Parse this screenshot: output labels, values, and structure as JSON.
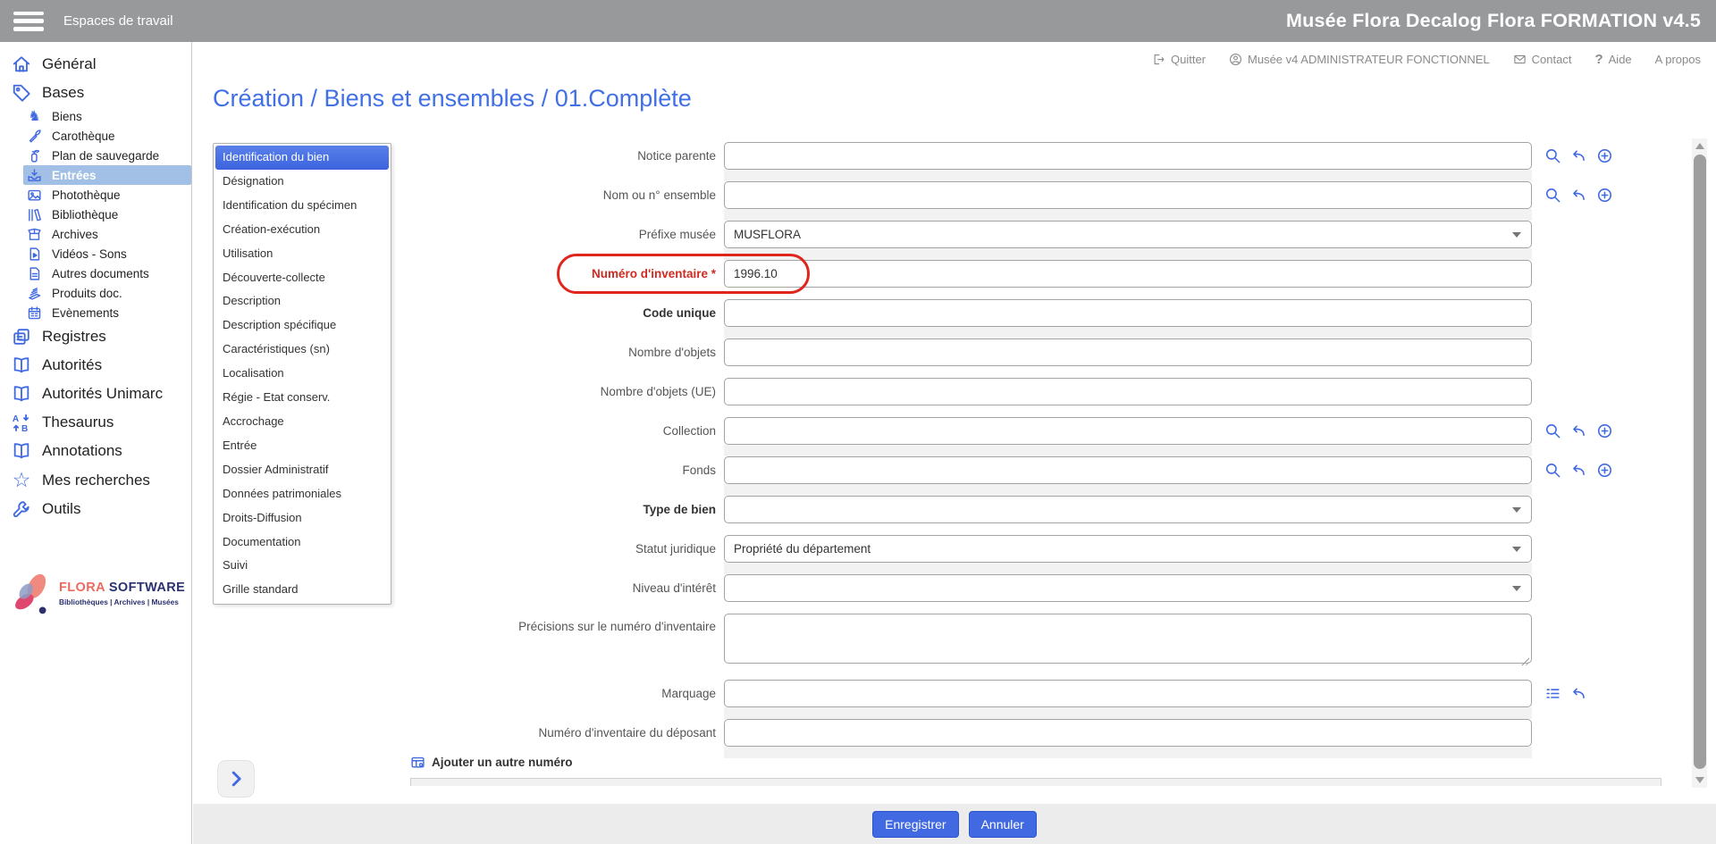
{
  "topbar": {
    "menu_label": "Espaces de travail",
    "app_title": "Musée Flora Decalog Flora FORMATION v4.5"
  },
  "utility": {
    "quit": "Quitter",
    "user": "Musée v4 ADMINISTRATEUR FONCTIONNEL",
    "contact": "Contact",
    "help": "Aide",
    "help_icon": "?",
    "about": "A propos"
  },
  "sidebar": {
    "items": [
      {
        "label": "Général",
        "icon": "house-icon"
      },
      {
        "label": "Bases",
        "icon": "tag-icon"
      },
      {
        "label": "Biens",
        "icon": "chess-knight-icon",
        "glyph": "♞"
      },
      {
        "label": "Carothèque",
        "icon": "carrot-icon"
      },
      {
        "label": "Plan de sauvegarde",
        "icon": "fire-extinguisher-icon"
      },
      {
        "label": "Entrées",
        "icon": "inbox-import-icon",
        "selected": true
      },
      {
        "label": "Photothèque",
        "icon": "image-icon"
      },
      {
        "label": "Bibliothèque",
        "icon": "books-icon"
      },
      {
        "label": "Archives",
        "icon": "archive-box-icon"
      },
      {
        "label": "Vidéos - Sons",
        "icon": "video-document-icon"
      },
      {
        "label": "Autres documents",
        "icon": "document-icon"
      },
      {
        "label": "Produits doc.",
        "icon": "papers-stack-icon"
      },
      {
        "label": "Evènements",
        "icon": "calendar-icon"
      },
      {
        "label": "Registres",
        "icon": "registers-icon"
      },
      {
        "label": "Autorités",
        "icon": "open-book-icon"
      },
      {
        "label": "Autorités Unimarc",
        "icon": "open-book-icon"
      },
      {
        "label": "Thesaurus",
        "icon": "sort-alpha-icon"
      },
      {
        "label": "Annotations",
        "icon": "open-book-icon"
      },
      {
        "label": "Mes recherches",
        "icon": "star-icon",
        "glyph": "☆"
      },
      {
        "label": "Outils",
        "icon": "wrench-icon"
      }
    ],
    "logo": {
      "brand_primary": "FLORA",
      "brand_secondary": "SOFTWARE",
      "tagline": "Bibliothèques | Archives | Musées"
    }
  },
  "page": {
    "title": "Création / Biens et ensembles / 01.Complète"
  },
  "tabs": [
    {
      "label": "Identification du bien",
      "selected": true
    },
    {
      "label": "Désignation"
    },
    {
      "label": "Identification du spécimen"
    },
    {
      "label": "Création-exécution"
    },
    {
      "label": "Utilisation"
    },
    {
      "label": "Découverte-collecte"
    },
    {
      "label": "Description"
    },
    {
      "label": "Description spécifique"
    },
    {
      "label": "Caractéristiques (sn)"
    },
    {
      "label": "Localisation"
    },
    {
      "label": "Régie - Etat conserv."
    },
    {
      "label": "Accrochage"
    },
    {
      "label": "Entrée"
    },
    {
      "label": "Dossier Administratif"
    },
    {
      "label": "Données patrimoniales"
    },
    {
      "label": "Droits-Diffusion"
    },
    {
      "label": "Documentation"
    },
    {
      "label": "Suivi"
    },
    {
      "label": "Grille standard"
    }
  ],
  "form": {
    "fields": [
      {
        "label": "Notice parente",
        "value": "",
        "type": "lookup"
      },
      {
        "label": "Nom ou n° ensemble",
        "value": "",
        "type": "lookup"
      },
      {
        "label": "Préfixe musée",
        "value": "MUSFLORA",
        "type": "select"
      },
      {
        "label": "Numéro d'inventaire *",
        "value": "1996.10",
        "type": "text",
        "required": true,
        "highlighted": true
      },
      {
        "label": "Code unique",
        "value": "",
        "type": "text",
        "bold": true
      },
      {
        "label": "Nombre d'objets",
        "value": "",
        "type": "text"
      },
      {
        "label": "Nombre d'objets (UE)",
        "value": "",
        "type": "text"
      },
      {
        "label": "Collection",
        "value": "",
        "type": "lookup"
      },
      {
        "label": "Fonds",
        "value": "",
        "type": "lookup"
      },
      {
        "label": "Type de bien",
        "value": "",
        "type": "select",
        "bold": true
      },
      {
        "label": "Statut juridique",
        "value": "Propriété du département",
        "type": "select"
      },
      {
        "label": "Niveau d'intérêt",
        "value": "",
        "type": "select"
      },
      {
        "label": "Précisions sur le numéro d'inventaire",
        "value": "",
        "type": "textarea"
      },
      {
        "label": "Marquage",
        "value": "",
        "type": "list-field"
      },
      {
        "label": "Numéro d'inventaire du déposant",
        "value": "",
        "type": "text"
      }
    ],
    "section_add_number": "Ajouter un autre numéro"
  },
  "footer": {
    "save": "Enregistrer",
    "cancel": "Annuler"
  },
  "colors": {
    "accent_blue": "#4169e1",
    "title_blue": "#4170e4",
    "topbar_gray": "#98999b",
    "selected_sidebar_bg": "#a2c0e6",
    "required_red": "#cf2a20",
    "annotation_red": "#e0261c",
    "footer_gray": "#ececec"
  }
}
